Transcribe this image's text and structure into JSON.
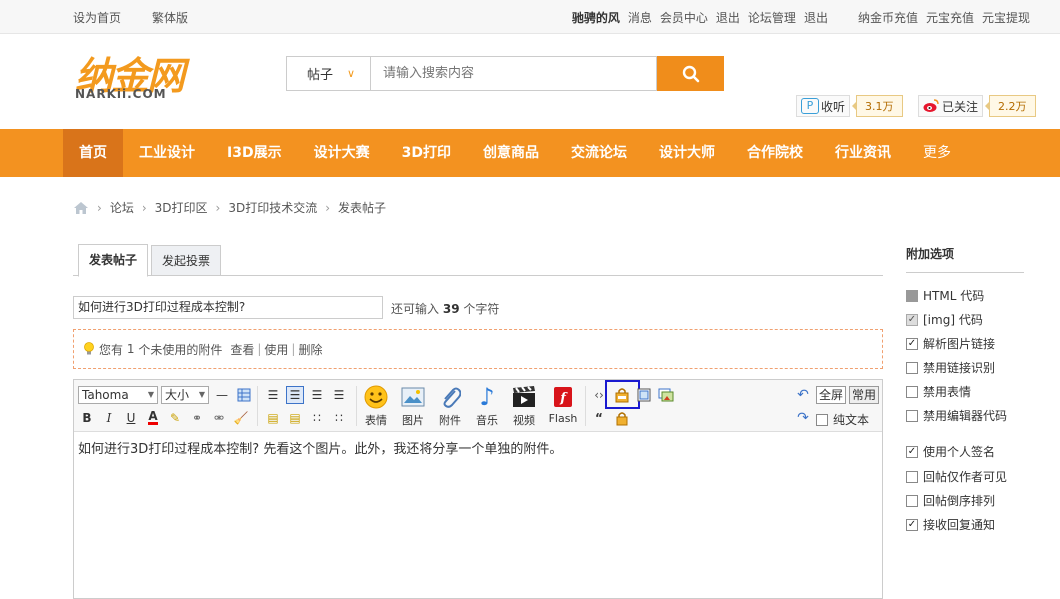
{
  "topbar": {
    "set_home": "设为首页",
    "traditional": "繁体版",
    "username": "驰骋的风",
    "messages": "消息",
    "member_center": "会员中心",
    "logout1": "退出",
    "forum_admin": "论坛管理",
    "logout2": "退出",
    "recharge_coin": "纳金币充值",
    "recharge_yuanbao": "元宝充值",
    "withdraw_yuanbao": "元宝提现"
  },
  "logo": {
    "cn": "纳金网",
    "en": "NARKii.COM"
  },
  "search": {
    "type": "帖子",
    "placeholder": "请输入搜索内容"
  },
  "social": {
    "listen_label": "收听",
    "listen_count": "3.1万",
    "weibo_label": "已关注",
    "weibo_count": "2.2万"
  },
  "nav": {
    "items": [
      "首页",
      "工业设计",
      "I3D展示",
      "设计大赛",
      "3D打印",
      "创意商品",
      "交流论坛",
      "设计大师",
      "合作院校",
      "行业资讯",
      "更多"
    ]
  },
  "breadcrumb": [
    "论坛",
    "3D打印区",
    "3D打印技术交流",
    "发表帖子"
  ],
  "tabs": {
    "post": "发表帖子",
    "poll": "发起投票"
  },
  "subject": {
    "value": "如何进行3D打印过程成本控制?",
    "remain_prefix": "还可输入",
    "remain_count": "39",
    "remain_suffix": "个字符"
  },
  "attach_notice": {
    "text_prefix": "您有",
    "count": "1",
    "text_suffix": "个未使用的附件",
    "view": "查看",
    "use": "使用",
    "delete": "删除"
  },
  "editor": {
    "font": "Tahoma",
    "size": "大小",
    "buttons": {
      "emoticon": "表情",
      "image": "图片",
      "attachment": "附件",
      "music": "音乐",
      "video": "视频",
      "flash": "Flash",
      "fullscreen": "全屏",
      "common": "常用",
      "plaintext": "纯文本"
    },
    "content": "如何进行3D打印过程成本控制? 先看这个图片。此外，我还将分享一个单独的附件。"
  },
  "sidebar": {
    "title": "附加选项",
    "options": [
      {
        "label": "HTML 代码",
        "state": "disabled"
      },
      {
        "label": "[img] 代码",
        "state": "disabled-checked"
      },
      {
        "label": "解析图片链接",
        "state": "checked"
      },
      {
        "label": "禁用链接识别",
        "state": "unchecked"
      },
      {
        "label": "禁用表情",
        "state": "unchecked"
      },
      {
        "label": "禁用编辑器代码",
        "state": "unchecked"
      },
      {
        "label": "使用个人签名",
        "state": "checked"
      },
      {
        "label": "回帖仅作者可见",
        "state": "unchecked"
      },
      {
        "label": "回帖倒序排列",
        "state": "unchecked"
      },
      {
        "label": "接收回复通知",
        "state": "checked"
      }
    ]
  },
  "colors": {
    "accent": "#f39220",
    "nav_active": "#d9741a",
    "highlight": "#1a1ad0"
  }
}
